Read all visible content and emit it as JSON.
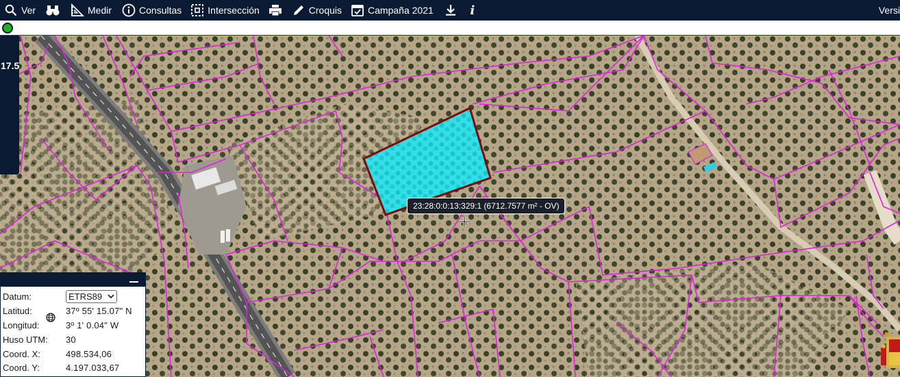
{
  "toolbar": {
    "items": [
      {
        "label": "Ver",
        "icon": "search-icon"
      },
      {
        "label": "",
        "icon": "binoculars-icon"
      },
      {
        "label": "Medir",
        "icon": "ruler-icon"
      },
      {
        "label": "Consultas",
        "icon": "info-circle-icon"
      },
      {
        "label": "Intersección",
        "icon": "intersection-icon"
      },
      {
        "label": "",
        "icon": "print-icon"
      },
      {
        "label": "Croquis",
        "icon": "pencil-icon"
      },
      {
        "label": "Campaña 2021",
        "icon": "calendar-icon"
      },
      {
        "label": "",
        "icon": "download-icon"
      },
      {
        "label": "",
        "icon": "info-i-icon"
      }
    ],
    "right_text": "Versi"
  },
  "status": {
    "indicator_color": "#20b020"
  },
  "zoom": {
    "value": "17.5"
  },
  "tooltip": {
    "text": "23:28:0:0:13:329:1 (6712.7577 m² - OV)"
  },
  "coords": {
    "datum_label": "Datum:",
    "datum_value": "ETRS89",
    "lat_label": "Latitud:",
    "lat_value": "37º 55' 15.07\" N",
    "lon_label": "Longitud:",
    "lon_value": "3º 1' 0.04\" W",
    "huso_label": "Huso UTM:",
    "huso_value": "30",
    "x_label": "Coord. X:",
    "x_value": "498.534,06",
    "y_label": "Coord. Y:",
    "y_value": "4.197.033,67"
  },
  "colors": {
    "toolbar_bg": "#0b1a33",
    "parcel_boundary": "#e020e0",
    "selected_parcel_fill": "#28e0e8",
    "selected_parcel_border": "#7a0c0c",
    "road": "#6a6a6a"
  }
}
